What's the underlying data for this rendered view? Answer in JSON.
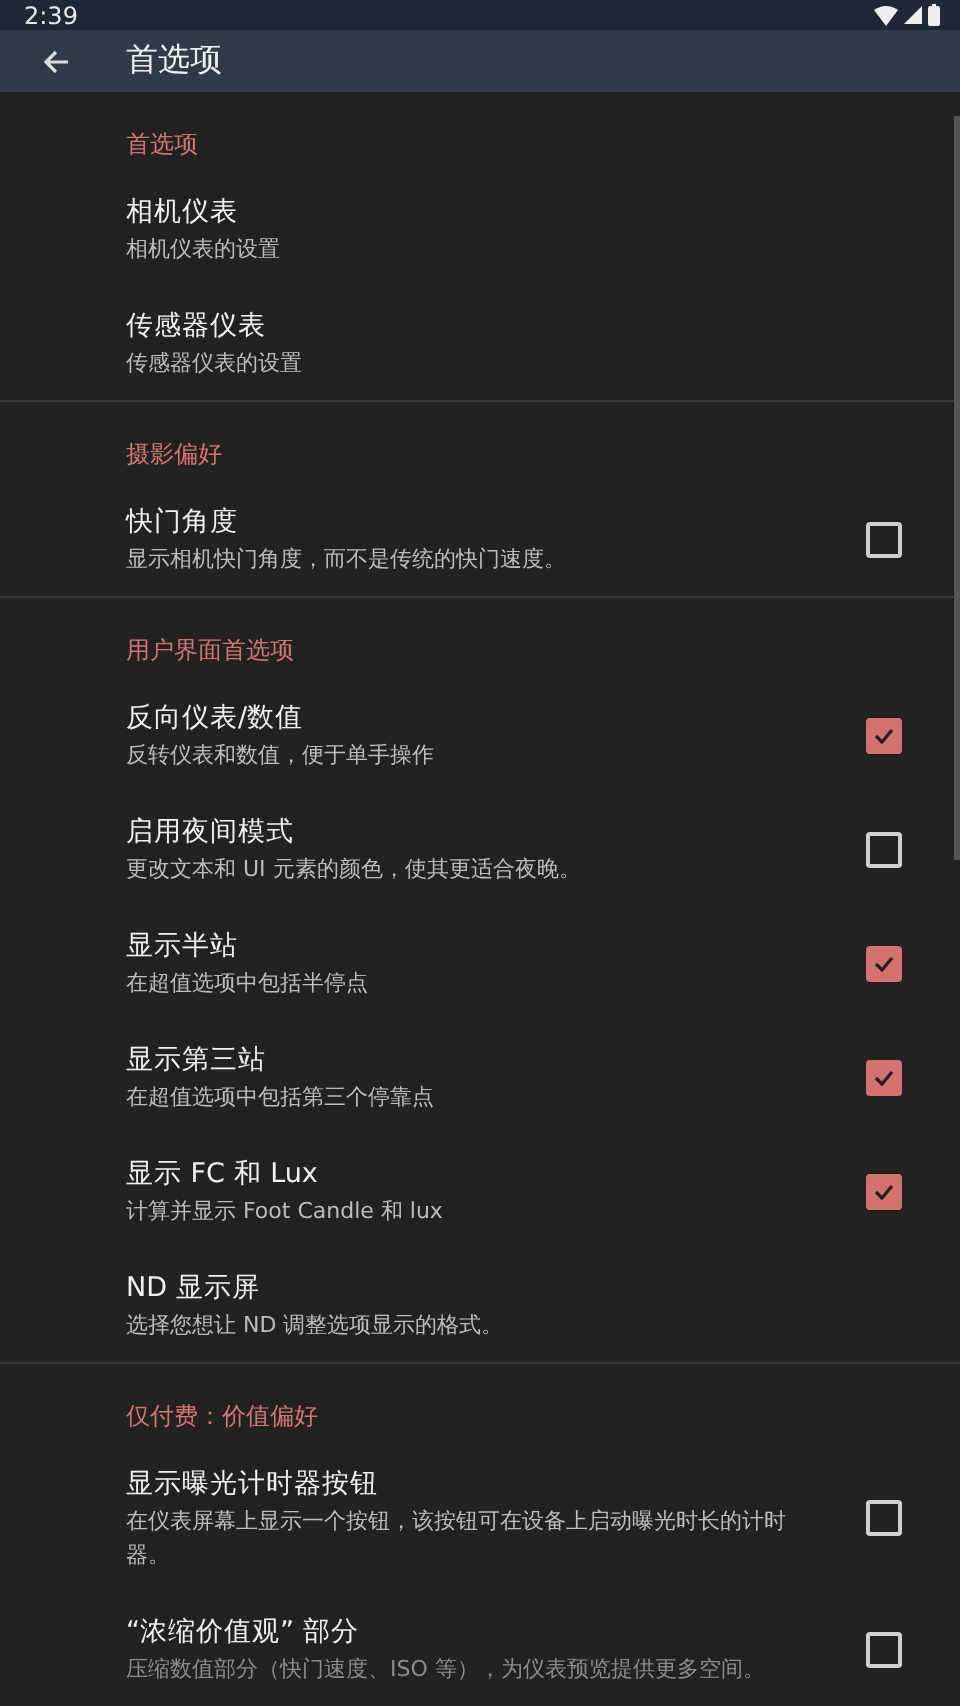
{
  "status_bar": {
    "time": "2:39"
  },
  "app_bar": {
    "title": "首选项"
  },
  "sections": [
    {
      "title": "首选项",
      "items": [
        {
          "kind": "link",
          "title": "相机仪表",
          "summary": "相机仪表的设置"
        },
        {
          "kind": "link",
          "title": "传感器仪表",
          "summary": "传感器仪表的设置"
        }
      ]
    },
    {
      "title": "摄影偏好",
      "items": [
        {
          "kind": "checkbox",
          "title": "快门角度",
          "summary": "显示相机快门角度，而不是传统的快门速度。",
          "checked": false
        }
      ]
    },
    {
      "title": "用户界面首选项",
      "items": [
        {
          "kind": "checkbox",
          "title": "反向仪表/数值",
          "summary": "反转仪表和数值，便于单手操作",
          "checked": true
        },
        {
          "kind": "checkbox",
          "title": "启用夜间模式",
          "summary": "更改文本和 UI 元素的颜色，使其更适合夜晚。",
          "checked": false
        },
        {
          "kind": "checkbox",
          "title": "显示半站",
          "summary": "在超值选项中包括半停点",
          "checked": true
        },
        {
          "kind": "checkbox",
          "title": "显示第三站",
          "summary": "在超值选项中包括第三个停靠点",
          "checked": true
        },
        {
          "kind": "checkbox",
          "title": "显示 FC 和 Lux",
          "summary": "计算并显示 Foot Candle 和 lux",
          "checked": true
        },
        {
          "kind": "link",
          "title": "ND 显示屏",
          "summary": "选择您想让 ND 调整选项显示的格式。"
        }
      ]
    },
    {
      "title": "仅付费：价值偏好",
      "items": [
        {
          "kind": "checkbox",
          "title": "显示曝光计时器按钮",
          "summary": "在仪表屏幕上显示一个按钮，该按钮可在设备上启动曝光时长的计时器。",
          "checked": false
        },
        {
          "kind": "checkbox",
          "title": "“浓缩价值观” 部分",
          "summary": "压缩数值部分（快门速度、ISO 等），为仪表预览提供更多空间。",
          "checked": false
        }
      ]
    }
  ]
}
